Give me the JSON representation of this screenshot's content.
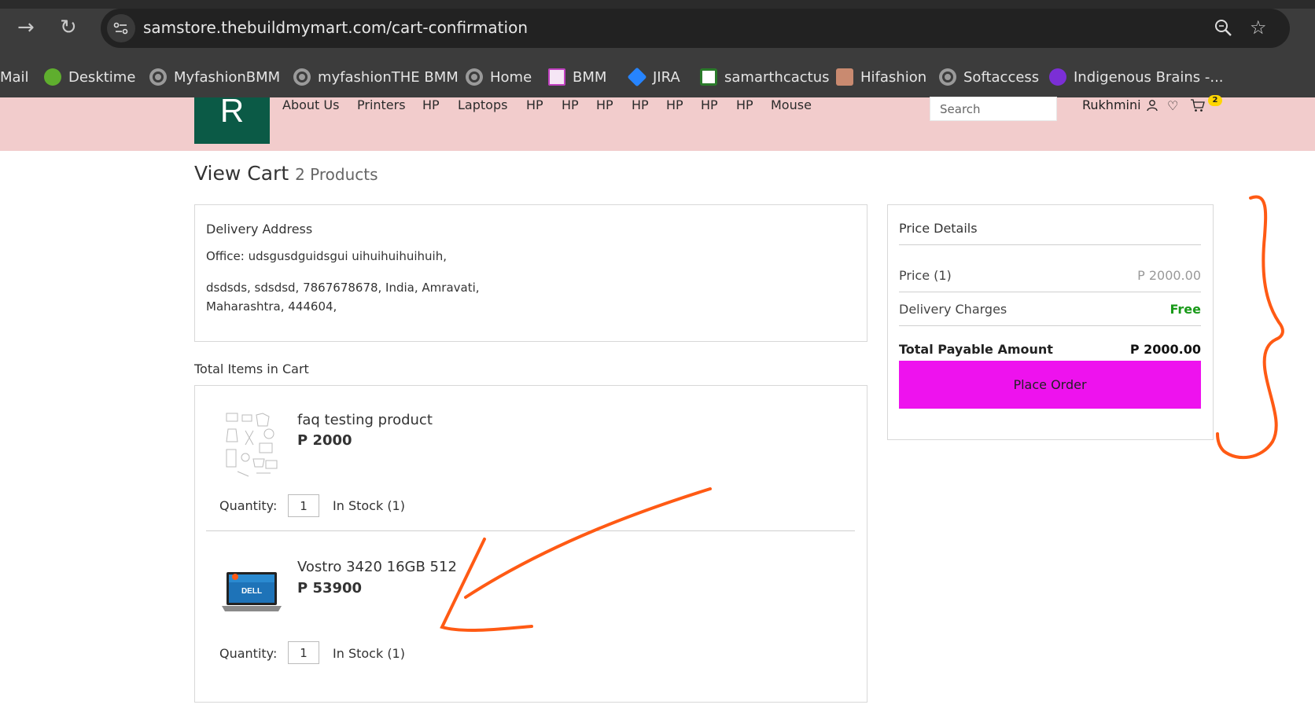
{
  "browser": {
    "url": "samstore.thebuildmymart.com/cart-confirmation",
    "bookmarks": [
      {
        "label": "Mail",
        "icon": "mail-icon"
      },
      {
        "label": "Desktime",
        "icon": "desktime-icon"
      },
      {
        "label": "MyfashionBMM",
        "icon": "globe-icon"
      },
      {
        "label": "myfashionTHE BMM",
        "icon": "globe-icon"
      },
      {
        "label": "Home",
        "icon": "globe-icon"
      },
      {
        "label": "BMM",
        "icon": "bmm-icon"
      },
      {
        "label": "JIRA",
        "icon": "jira-icon"
      },
      {
        "label": "samarthcactus",
        "icon": "cactus-icon"
      },
      {
        "label": "Hifashion",
        "icon": "hifashion-icon"
      },
      {
        "label": "Softaccess",
        "icon": "globe-icon"
      },
      {
        "label": "Indigenous Brains -...",
        "icon": "indigenous-icon"
      }
    ]
  },
  "header": {
    "logo_letter": "R",
    "nav": [
      "About Us",
      "Printers",
      "HP",
      "Laptops",
      "HP",
      "HP",
      "HP",
      "HP",
      "HP",
      "HP",
      "HP",
      "Mouse"
    ],
    "search_placeholder": "Search",
    "user_name": "Rukhmini",
    "cart_count": "2"
  },
  "page": {
    "title": "View Cart",
    "product_count": "2 Products"
  },
  "delivery": {
    "title": "Delivery Address",
    "line1": "Office: udsgusdguidsgui uihuihuihuihuih,",
    "line2": "dsdsds, sdsdsd, 7867678678, India, Amravati,",
    "line3": "Maharashtra, 444604,"
  },
  "cart": {
    "section_label": "Total Items in Cart",
    "items": [
      {
        "name": "faq testing product",
        "price": "P 2000",
        "qty_label": "Quantity:",
        "qty": "1",
        "stock": "In Stock (1)"
      },
      {
        "name": "Vostro 3420 16GB 512",
        "price": "P 53900",
        "qty_label": "Quantity:",
        "qty": "1",
        "stock": "In Stock (1)"
      }
    ]
  },
  "price_details": {
    "title": "Price Details",
    "price_label": "Price  (1)",
    "price_value": "P 2000.00",
    "delivery_label": "Delivery Charges",
    "delivery_value": "Free",
    "total_label": "Total Payable Amount",
    "total_value": "P  2000.00",
    "button": "Place Order"
  },
  "colors": {
    "header_bg": "#f2cccc",
    "logo_bg": "#0b5a46",
    "place_order": "#ee12ee",
    "free_text": "#1a9a1a",
    "annotation": "#ff5a14"
  }
}
